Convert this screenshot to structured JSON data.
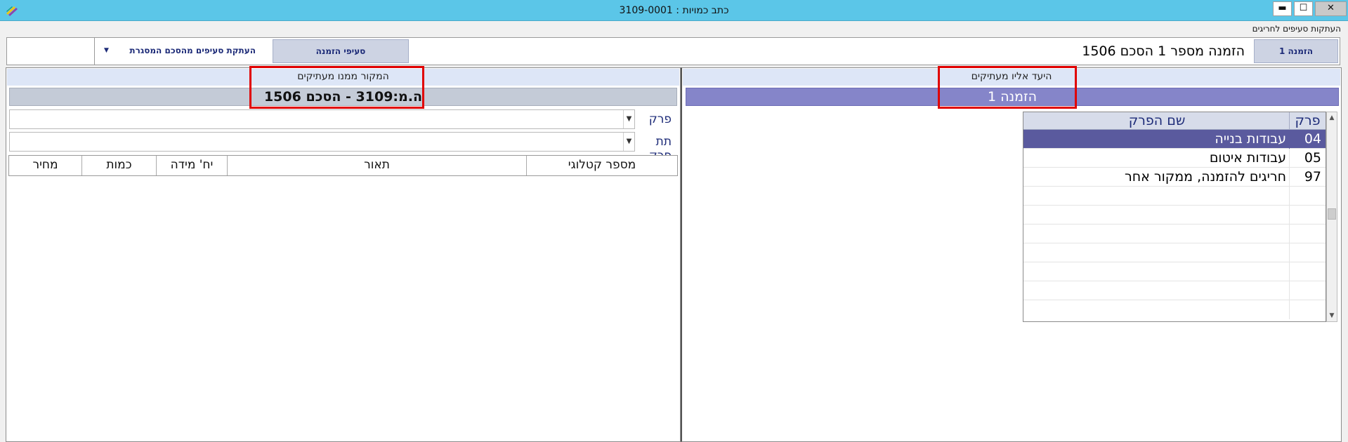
{
  "window": {
    "title": "כתב כמויות : 3109-0001",
    "minimize_label": "▬",
    "maximize_label": "☐",
    "close_label": "✕"
  },
  "menu": {
    "item": "העתקות סעיפים לחריגים"
  },
  "toolbar": {
    "order_tab": "הזמנה 1",
    "order_text": "הזמנה מספר 1 הסכם 1506",
    "items_tab": "סעיפי הזמנה",
    "copy_button": "העתקת סעיפים מהסכם המסגרת",
    "copy_arrow": "▼"
  },
  "left_panel": {
    "header": "המקור ממנו מעתיקים",
    "source": "ה.מ:3109 - הסכם 1506",
    "chapter_label": "פרק",
    "subchapter_label": "תת פרק",
    "dropdown_arrow": "▼",
    "columns": [
      "מספר קטלוגי",
      "תאור",
      "יח' מידה",
      "כמות",
      "מחיר"
    ]
  },
  "right_panel": {
    "header": "היעד אליו מעתיקים",
    "destination": "הזמנה 1",
    "columns": {
      "chapter": "פרק",
      "chapter_name": "שם הפרק"
    },
    "rows": [
      {
        "num": "04",
        "name": "עבודות בנייה"
      },
      {
        "num": "05",
        "name": "עבודות איטום"
      },
      {
        "num": "97",
        "name": "חריגים להזמנה, ממקור אחר"
      }
    ],
    "scroll_up": "▲",
    "scroll_down": "▼"
  },
  "colors": {
    "titlebar": "#5bc6e8",
    "destination_bar": "#8585c9",
    "selected_row": "#5a5a9e",
    "highlight": "#e00000",
    "label_text": "#1d2b78"
  }
}
